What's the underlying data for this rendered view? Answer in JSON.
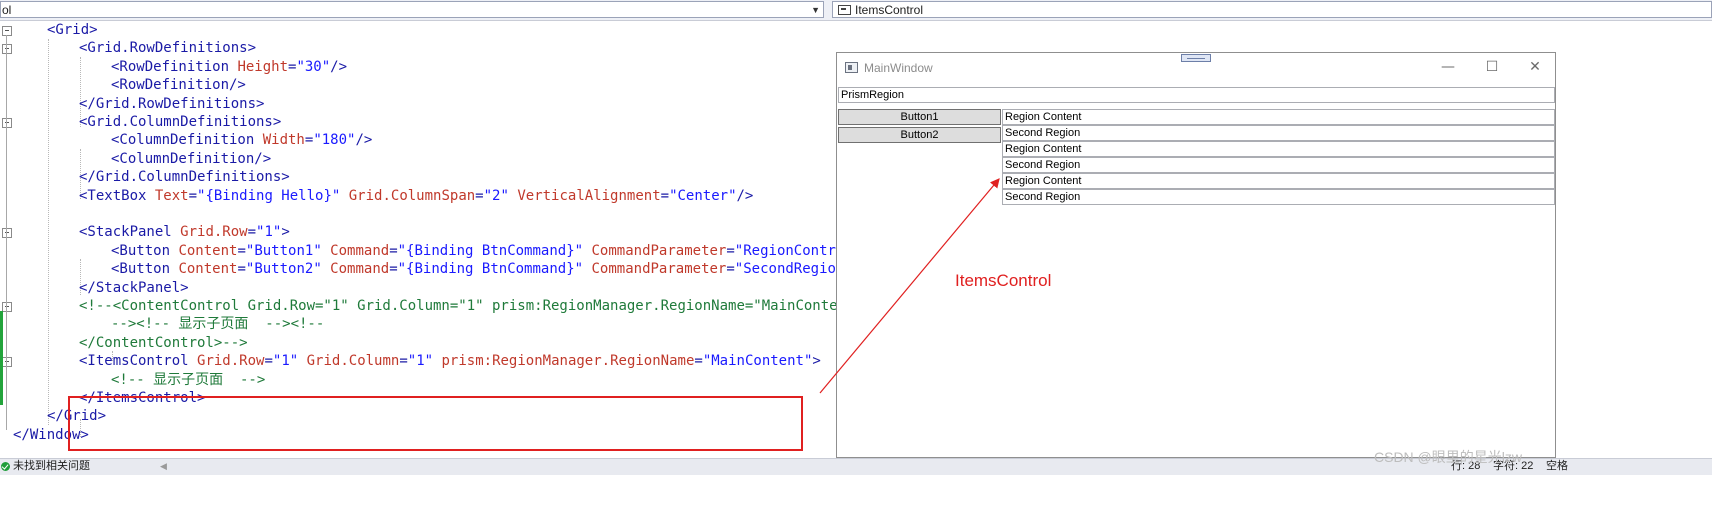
{
  "navbar": {
    "left_value": "ol",
    "right_value": "ItemsControl"
  },
  "code_lines": [
    {
      "indent": 0,
      "segments": [
        [
          "tag",
          "<Grid>"
        ]
      ]
    },
    {
      "indent": 1,
      "segments": [
        [
          "tag",
          "<Grid.RowDefinitions>"
        ]
      ]
    },
    {
      "indent": 2,
      "segments": [
        [
          "tag",
          "<RowDefinition "
        ],
        [
          "attr",
          "Height"
        ],
        [
          "tag",
          "="
        ],
        [
          "val",
          "\"30\""
        ],
        [
          "tag",
          "/>"
        ]
      ]
    },
    {
      "indent": 2,
      "segments": [
        [
          "tag",
          "<RowDefinition/>"
        ]
      ]
    },
    {
      "indent": 1,
      "segments": [
        [
          "tag",
          "</Grid.RowDefinitions>"
        ]
      ]
    },
    {
      "indent": 1,
      "segments": [
        [
          "tag",
          "<Grid.ColumnDefinitions>"
        ]
      ]
    },
    {
      "indent": 2,
      "segments": [
        [
          "tag",
          "<ColumnDefinition "
        ],
        [
          "attr",
          "Width"
        ],
        [
          "tag",
          "="
        ],
        [
          "val",
          "\"180\""
        ],
        [
          "tag",
          "/>"
        ]
      ]
    },
    {
      "indent": 2,
      "segments": [
        [
          "tag",
          "<ColumnDefinition/>"
        ]
      ]
    },
    {
      "indent": 1,
      "segments": [
        [
          "tag",
          "</Grid.ColumnDefinitions>"
        ]
      ]
    },
    {
      "indent": 1,
      "segments": [
        [
          "tag",
          "<TextBox "
        ],
        [
          "attr",
          "Text"
        ],
        [
          "tag",
          "="
        ],
        [
          "val",
          "\"{Binding Hello}\""
        ],
        [
          "attr",
          " Grid.ColumnSpan"
        ],
        [
          "tag",
          "="
        ],
        [
          "val",
          "\"2\""
        ],
        [
          "attr",
          " VerticalAlignment"
        ],
        [
          "tag",
          "="
        ],
        [
          "val",
          "\"Center\""
        ],
        [
          "tag",
          "/>"
        ]
      ]
    },
    {
      "indent": 1,
      "segments": []
    },
    {
      "indent": 1,
      "segments": [
        [
          "tag",
          "<StackPanel "
        ],
        [
          "attr",
          "Grid.Row"
        ],
        [
          "tag",
          "="
        ],
        [
          "val",
          "\"1\""
        ],
        [
          "tag",
          ">"
        ]
      ]
    },
    {
      "indent": 2,
      "segments": [
        [
          "tag",
          "<Button "
        ],
        [
          "attr",
          "Content"
        ],
        [
          "tag",
          "="
        ],
        [
          "val",
          "\"Button1\""
        ],
        [
          "attr",
          " Command"
        ],
        [
          "tag",
          "="
        ],
        [
          "val",
          "\"{Binding BtnCommand}\""
        ],
        [
          "attr",
          " CommandParameter"
        ],
        [
          "tag",
          "="
        ],
        [
          "val",
          "\"RegionControlVi"
        ]
      ]
    },
    {
      "indent": 2,
      "segments": [
        [
          "tag",
          "<Button "
        ],
        [
          "attr",
          "Content"
        ],
        [
          "tag",
          "="
        ],
        [
          "val",
          "\"Button2\""
        ],
        [
          "attr",
          " Command"
        ],
        [
          "tag",
          "="
        ],
        [
          "val",
          "\"{Binding BtnCommand}\""
        ],
        [
          "attr",
          " CommandParameter"
        ],
        [
          "tag",
          "="
        ],
        [
          "val",
          "\"SecondRegionVie"
        ]
      ]
    },
    {
      "indent": 1,
      "segments": [
        [
          "tag",
          "</StackPanel>"
        ]
      ]
    },
    {
      "indent": 1,
      "segments": [
        [
          "com",
          "<!--<ContentControl Grid.Row=\"1\" Grid.Column=\"1\" prism:RegionManager.RegionName=\"MainContent\""
        ]
      ]
    },
    {
      "indent": 2,
      "segments": [
        [
          "com",
          "--><!-- 显示子页面  --><!--"
        ]
      ]
    },
    {
      "indent": 1,
      "segments": [
        [
          "com",
          "</ContentControl>-->"
        ]
      ]
    },
    {
      "indent": 1,
      "segments": [
        [
          "tag",
          "<ItemsControl "
        ],
        [
          "attr",
          "Grid.Row"
        ],
        [
          "tag",
          "="
        ],
        [
          "val",
          "\"1\""
        ],
        [
          "attr",
          " Grid.Column"
        ],
        [
          "tag",
          "="
        ],
        [
          "val",
          "\"1\""
        ],
        [
          "attr",
          " prism:RegionManager.RegionName"
        ],
        [
          "tag",
          "="
        ],
        [
          "val",
          "\"MainContent\""
        ],
        [
          "tag",
          ">"
        ]
      ]
    },
    {
      "indent": 2,
      "segments": [
        [
          "com",
          "<!-- 显示子页面  -->"
        ]
      ]
    },
    {
      "indent": 1,
      "segments": [
        [
          "tag",
          "</ItemsControl>"
        ]
      ]
    },
    {
      "indent": 0,
      "segments": [
        [
          "tag",
          "</Grid>"
        ]
      ]
    },
    {
      "indent": -1,
      "segments": [
        [
          "tag",
          "</Window>"
        ]
      ]
    }
  ],
  "window": {
    "title": "MainWindow",
    "minimize_glyph": "—",
    "maximize_glyph": "☐",
    "close_glyph": "✕",
    "textbox_value": "PrismRegion",
    "buttons": [
      "Button1",
      "Button2"
    ],
    "regions": [
      "Region Content",
      "Second Region",
      "Region Content",
      "Second Region",
      "Region Content",
      "Second Region"
    ]
  },
  "annotation": {
    "label": "ItemsControl",
    "color": "#e02020"
  },
  "statusbar": {
    "message": "未找到相关问题",
    "line": "行: 28",
    "column": "字符: 22",
    "extra": "空格"
  },
  "watermark": "CSDN @眼里的星光lzw"
}
